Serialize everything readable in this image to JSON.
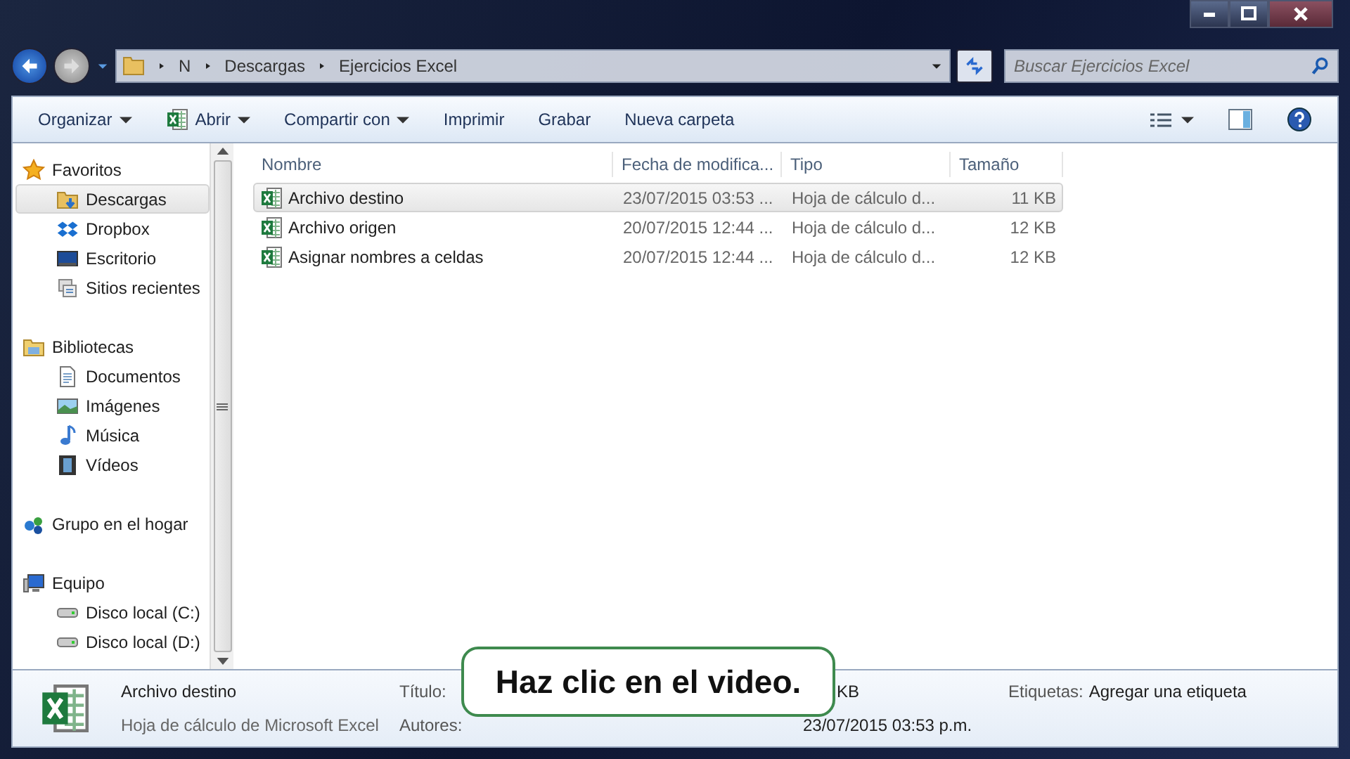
{
  "breadcrumb": [
    "N",
    "Descargas",
    "Ejercicios Excel"
  ],
  "search": {
    "placeholder": "Buscar Ejercicios Excel"
  },
  "toolbar": [
    {
      "label": "Organizar",
      "dropdown": true,
      "kind": "plain"
    },
    {
      "label": "Abrir",
      "dropdown": true,
      "kind": "excel"
    },
    {
      "label": "Compartir con",
      "dropdown": true,
      "kind": "plain"
    },
    {
      "label": "Imprimir",
      "dropdown": false,
      "kind": "plain"
    },
    {
      "label": "Grabar",
      "dropdown": false,
      "kind": "plain"
    },
    {
      "label": "Nueva carpeta",
      "dropdown": false,
      "kind": "plain"
    }
  ],
  "sidebar": {
    "groups": [
      {
        "label": "Favoritos",
        "kind": "star",
        "children": [
          {
            "label": "Descargas",
            "kind": "download",
            "selected": true
          },
          {
            "label": "Dropbox",
            "kind": "dropbox",
            "selected": false
          },
          {
            "label": "Escritorio",
            "kind": "desktop",
            "selected": false
          },
          {
            "label": "Sitios recientes",
            "kind": "recent",
            "selected": false
          }
        ]
      },
      {
        "label": "Bibliotecas",
        "kind": "library",
        "children": [
          {
            "label": "Documentos",
            "kind": "document",
            "selected": false
          },
          {
            "label": "Imágenes",
            "kind": "image",
            "selected": false
          },
          {
            "label": "Música",
            "kind": "music",
            "selected": false
          },
          {
            "label": "Vídeos",
            "kind": "video",
            "selected": false
          }
        ]
      },
      {
        "label": "Grupo en el hogar",
        "kind": "homegroup"
      },
      {
        "label": "Equipo",
        "kind": "computer",
        "children": [
          {
            "label": "Disco local (C:)",
            "kind": "drive",
            "selected": false
          },
          {
            "label": "Disco local (D:)",
            "kind": "drive",
            "selected": false
          }
        ]
      }
    ]
  },
  "table": {
    "columns": [
      "Nombre",
      "Fecha de modifica...",
      "Tipo",
      "Tamaño"
    ],
    "rows": [
      {
        "cells": [
          "Archivo destino",
          "23/07/2015 03:53 ...",
          "Hoja de cálculo d...",
          "11 KB"
        ],
        "selected": true
      },
      {
        "cells": [
          "Archivo origen",
          "20/07/2015 12:44 ...",
          "Hoja de cálculo d...",
          "12 KB"
        ],
        "selected": false
      },
      {
        "cells": [
          "Asignar nombres a celdas",
          "20/07/2015 12:44 ...",
          "Hoja de cálculo d...",
          "12 KB"
        ],
        "selected": false
      }
    ]
  },
  "details": {
    "name": "Archivo destino",
    "type": "Hoja de cálculo de Microsoft Excel",
    "labels": [
      "Título:",
      "Autores:"
    ],
    "size_tail": "KB",
    "date_tail": "23/07/2015 03:53 p.m.",
    "tags_label": "Etiquetas:",
    "tags_value": "Agregar una etiqueta"
  },
  "callout": "Haz clic en el video."
}
